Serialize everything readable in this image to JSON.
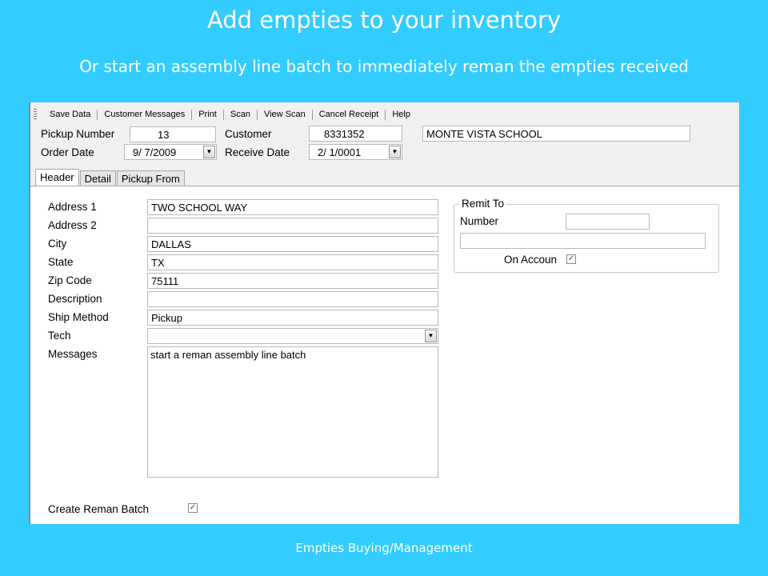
{
  "slide": {
    "title": "Add empties to your inventory",
    "subtitle": "Or start an assembly line batch to immediately reman the empties received",
    "footer": "Empties Buying/Management"
  },
  "toolbar": {
    "items": [
      "Save Data",
      "Customer Messages",
      "Print",
      "Scan",
      "View Scan",
      "Cancel Receipt",
      "Help"
    ]
  },
  "form": {
    "pickup_number_label": "Pickup Number",
    "pickup_number": "13",
    "customer_label": "Customer",
    "customer_id": "8331352",
    "customer_name": "MONTE VISTA SCHOOL",
    "order_date_label": "Order Date",
    "order_date": "9/ 7/2009",
    "receive_date_label": "Receive Date",
    "receive_date": "2/ 1/0001"
  },
  "tabs": [
    "Header",
    "Detail",
    "Pickup From"
  ],
  "header": {
    "address1_label": "Address 1",
    "address1": "TWO SCHOOL WAY",
    "address2_label": "Address 2",
    "address2": "",
    "city_label": "City",
    "city": "DALLAS",
    "state_label": "State",
    "state": "TX",
    "zip_label": "Zip Code",
    "zip": "75111",
    "description_label": "Description",
    "description": "",
    "ship_method_label": "Ship Method",
    "ship_method": "Pickup",
    "tech_label": "Tech",
    "tech": "",
    "messages_label": "Messages",
    "messages": "start a reman assembly line batch",
    "create_batch_label": "Create Reman Batch",
    "create_batch_checked": true
  },
  "remit": {
    "title": "Remit To",
    "number_label": "Number",
    "number": "",
    "name": "",
    "on_account_label": "On Accoun",
    "on_account_checked": true
  }
}
